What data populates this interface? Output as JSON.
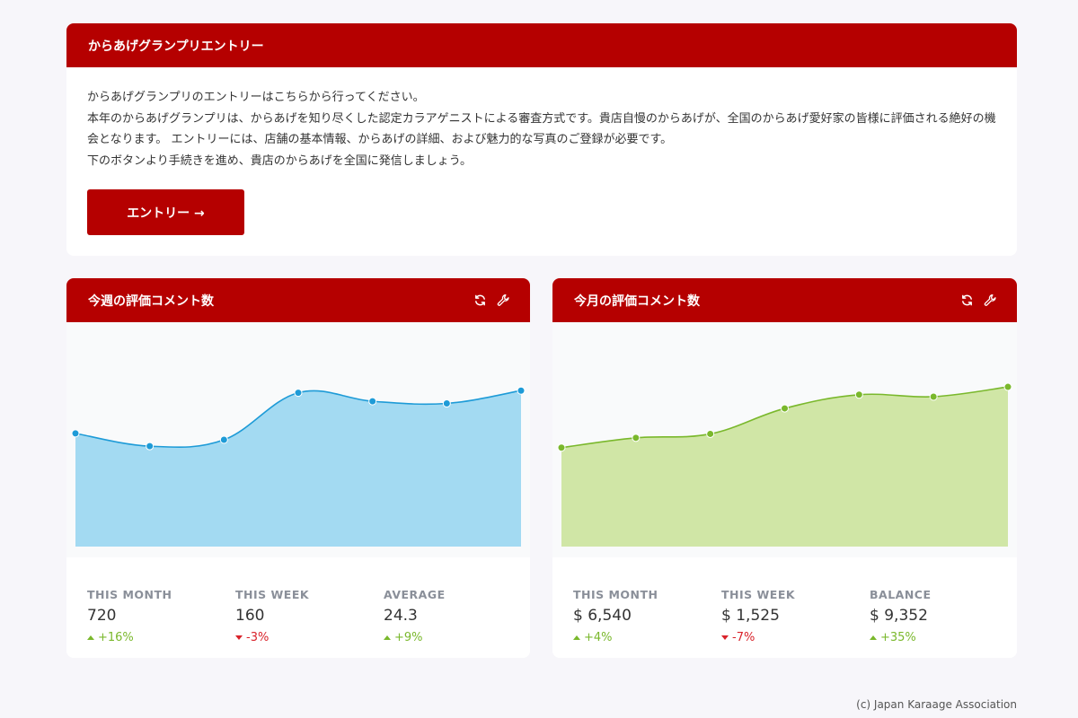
{
  "entry": {
    "title": "からあげグランプリエントリー",
    "lines": [
      "からあげグランプリのエントリーはこちらから行ってください。",
      "本年のからあげグランプリは、からあげを知り尽くした認定カラアゲニストによる審査方式です。貴店自慢のからあげが、全国のからあげ愛好家の皆様に評価される絶好の機会となります。 エントリーには、店舗の基本情報、からあげの詳細、および魅力的な写真のご登録が必要です。",
      "下のボタンより手続きを進め、貴店のからあげを全国に発信しましょう。"
    ],
    "button_label": "エントリー →"
  },
  "week_panel": {
    "title": "今週の評価コメント数",
    "stats": [
      {
        "label": "THIS MONTH",
        "value": "720",
        "change": "+16%",
        "trend": "up"
      },
      {
        "label": "THIS WEEK",
        "value": "160",
        "change": "-3%",
        "trend": "down"
      },
      {
        "label": "AVERAGE",
        "value": "24.3",
        "change": "+9%",
        "trend": "up"
      }
    ]
  },
  "month_panel": {
    "title": "今月の評価コメント数",
    "stats": [
      {
        "label": "THIS MONTH",
        "value": "$ 6,540",
        "change": "+4%",
        "trend": "up"
      },
      {
        "label": "THIS WEEK",
        "value": "$ 1,525",
        "change": "-7%",
        "trend": "down"
      },
      {
        "label": "BALANCE",
        "value": "$ 9,352",
        "change": "+35%",
        "trend": "up"
      }
    ]
  },
  "icons": {
    "refresh": "refresh-icon",
    "settings": "wrench-icon"
  },
  "colors": {
    "brand": "#b50000",
    "week_line": "#1e9bd7",
    "week_fill": "#a3daf2",
    "month_line": "#7ab82c",
    "month_fill": "#d0e6a6",
    "positive": "#7ab82c",
    "negative": "#d9222a"
  },
  "chart_data": [
    {
      "type": "area",
      "values": [
        33,
        27,
        30,
        52,
        48,
        47,
        53
      ],
      "ylim": [
        -25,
        85
      ],
      "grid": false
    },
    {
      "type": "area",
      "values": [
        26,
        31,
        33,
        46,
        53,
        52,
        57
      ],
      "ylim": [
        -30,
        90
      ],
      "grid": false
    }
  ],
  "footer": "(c) Japan Karaage Association"
}
